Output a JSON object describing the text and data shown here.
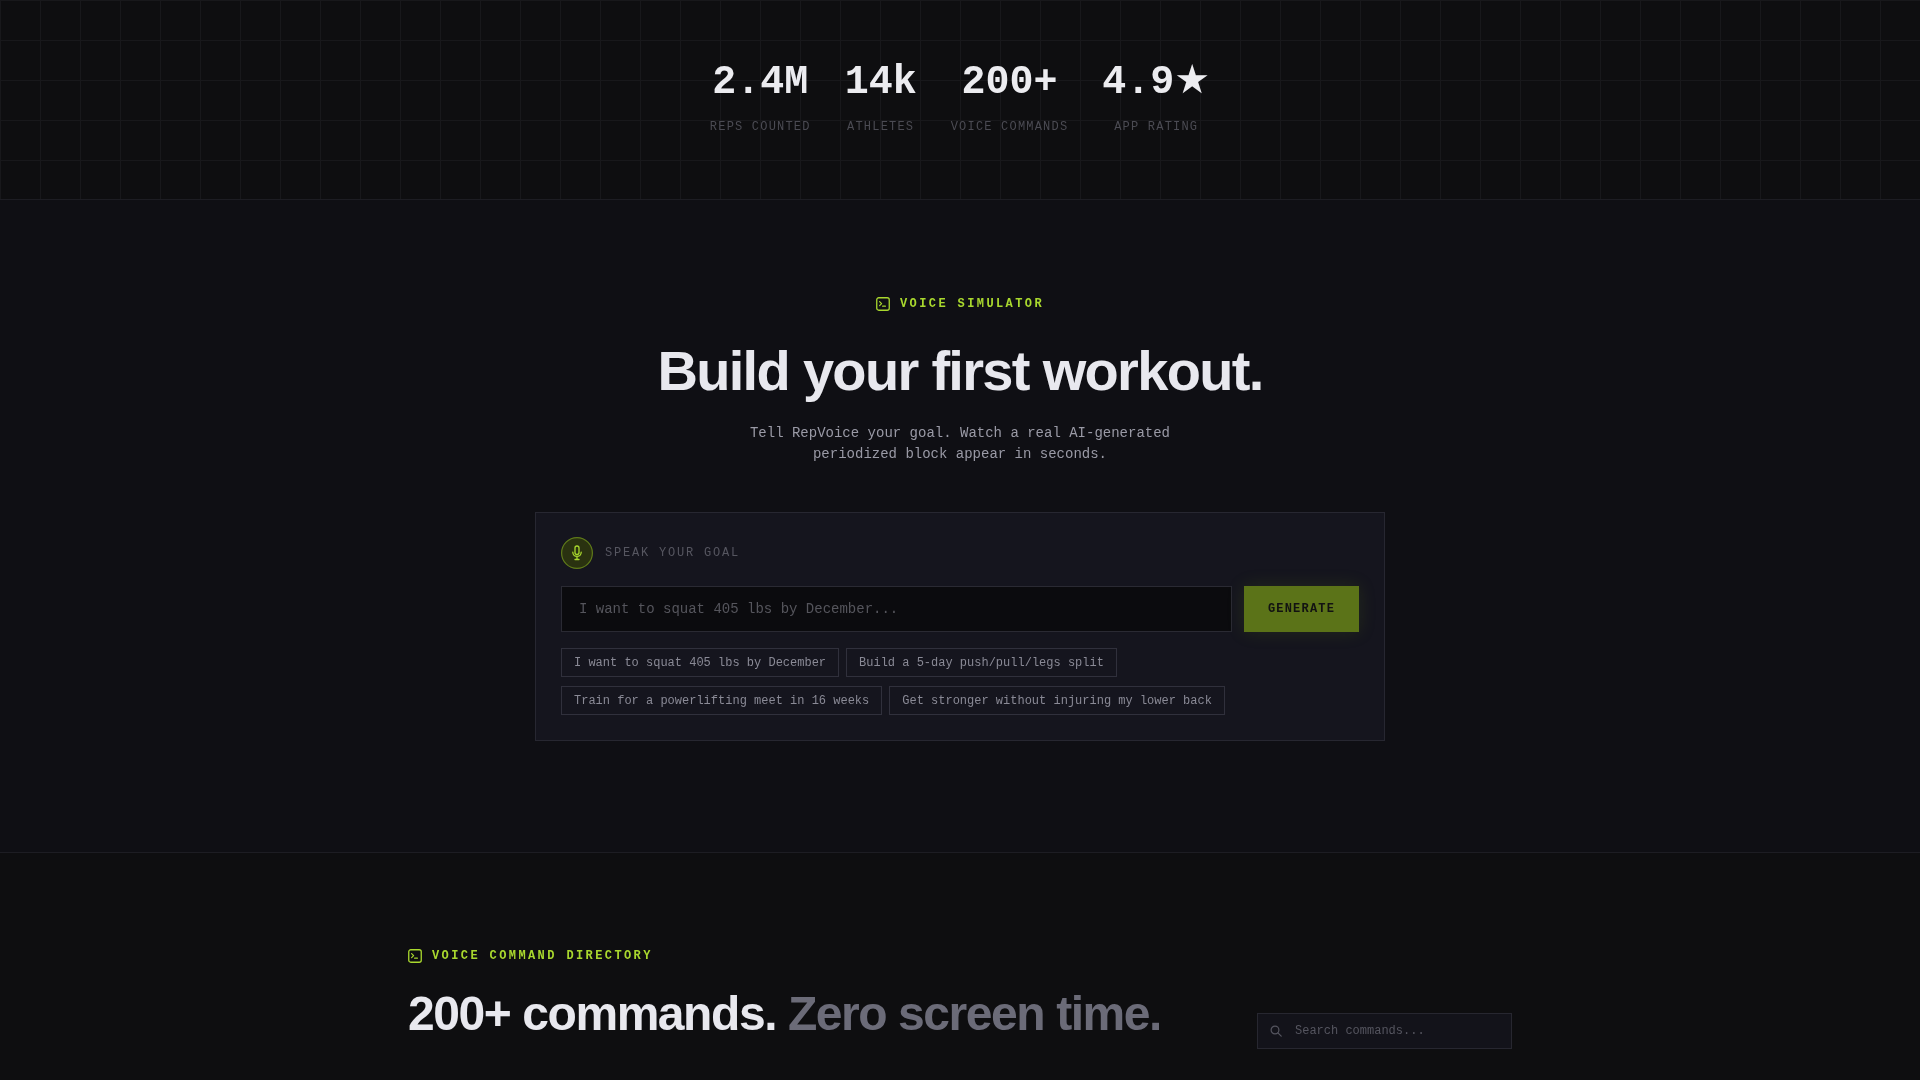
{
  "stats": [
    {
      "value": "2.4M",
      "label": "REPS COUNTED"
    },
    {
      "value": "14k",
      "label": "ATHLETES"
    },
    {
      "value": "200+",
      "label": "VOICE COMMANDS"
    },
    {
      "value": "4.9★",
      "label": "APP RATING"
    }
  ],
  "simulator": {
    "eyebrow": "VOICE SIMULATOR",
    "title": "Build your first workout.",
    "subtitle": "Tell RepVoice your goal. Watch a real AI-generated periodized block appear in seconds.",
    "card": {
      "label": "SPEAK YOUR GOAL",
      "input": {
        "placeholder": "I want to squat 405 lbs by December..."
      },
      "button": "GENERATE",
      "suggestions": [
        "I want to squat 405 lbs by December",
        "Build a 5-day push/pull/legs split",
        "Train for a powerlifting meet in 16 weeks",
        "Get stronger without injuring my lower back"
      ]
    }
  },
  "directory": {
    "eyebrow": "VOICE COMMAND DIRECTORY",
    "title": "200+ commands.",
    "title_muted": "Zero screen time.",
    "search": {
      "placeholder": "Search commands..."
    }
  }
}
